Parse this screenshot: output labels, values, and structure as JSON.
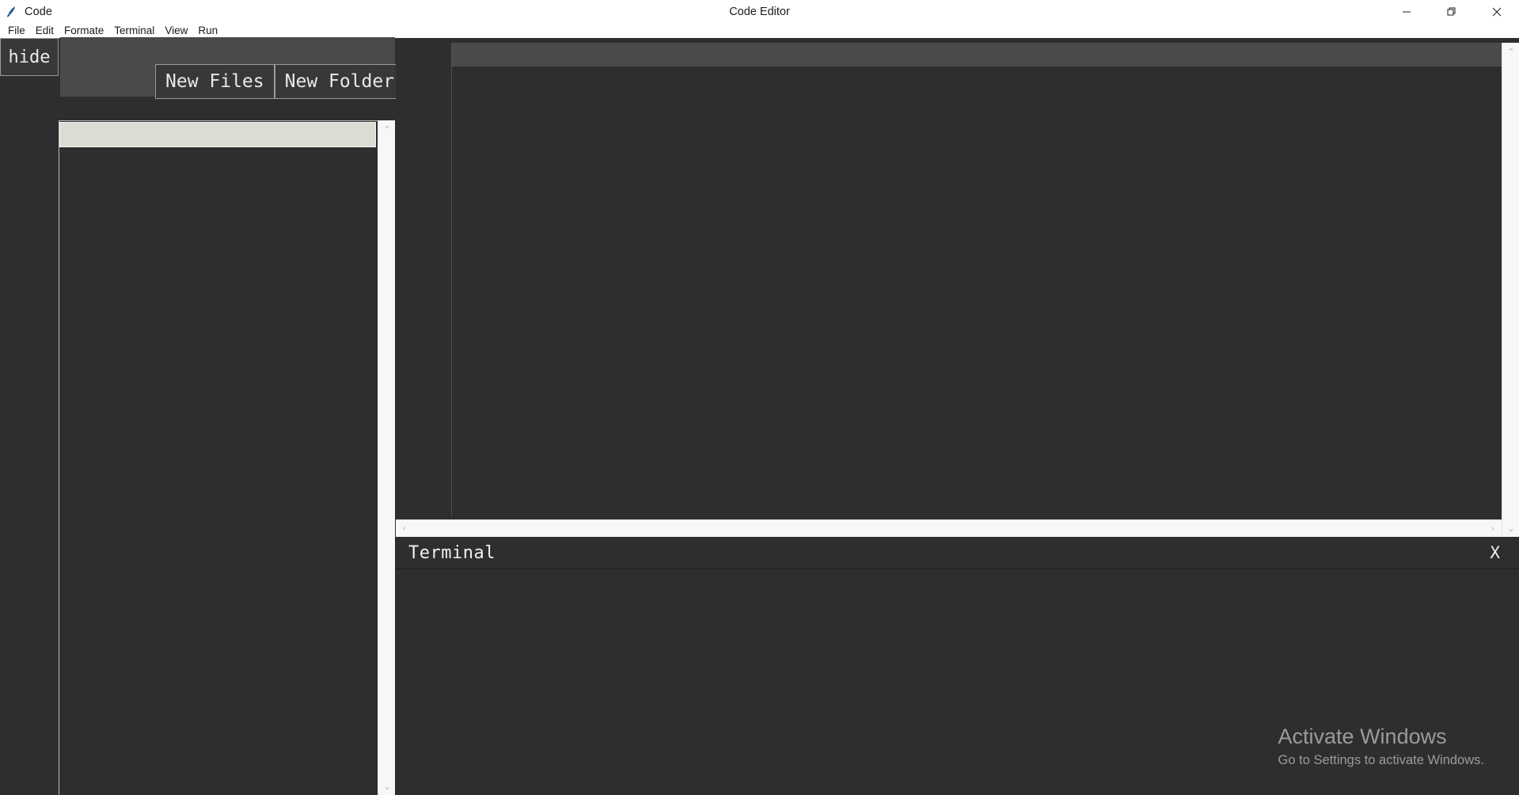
{
  "window": {
    "app_name": "Code",
    "title": "Code Editor",
    "icon": "python-feather-icon",
    "controls": {
      "minimize": "minimize-icon",
      "restore": "restore-icon",
      "close": "close-icon"
    }
  },
  "menubar": {
    "items": [
      {
        "label": "File"
      },
      {
        "label": "Edit"
      },
      {
        "label": "Formate"
      },
      {
        "label": "Terminal"
      },
      {
        "label": "View"
      },
      {
        "label": "Run"
      }
    ]
  },
  "explorer": {
    "hide_button": "hide",
    "new_file_button": "New Files",
    "new_folder_button": "New Folder",
    "header_row_text": "",
    "tree_items": []
  },
  "editor": {
    "tabs": [],
    "content": "",
    "gutter": ""
  },
  "terminal": {
    "title": "Terminal",
    "close_label": "X",
    "content": ""
  },
  "scrollbars": {
    "up_arrow": "⌃",
    "down_arrow": "⌄",
    "left_arrow": "‹",
    "right_arrow": "›"
  },
  "watermark": {
    "title": "Activate Windows",
    "subtitle": "Go to Settings to activate Windows."
  },
  "colors": {
    "chrome_bg": "#ffffff",
    "panel_bg": "#2e2e2e",
    "toolbar_bg": "#4a4a4a",
    "button_bg": "#383838",
    "button_border": "#9a9a9a",
    "header_row": "#dcdbd4",
    "scrollbar_track": "#f7f7f7",
    "text_light": "#e9e9e9",
    "watermark_text": "#9b9b9b"
  }
}
